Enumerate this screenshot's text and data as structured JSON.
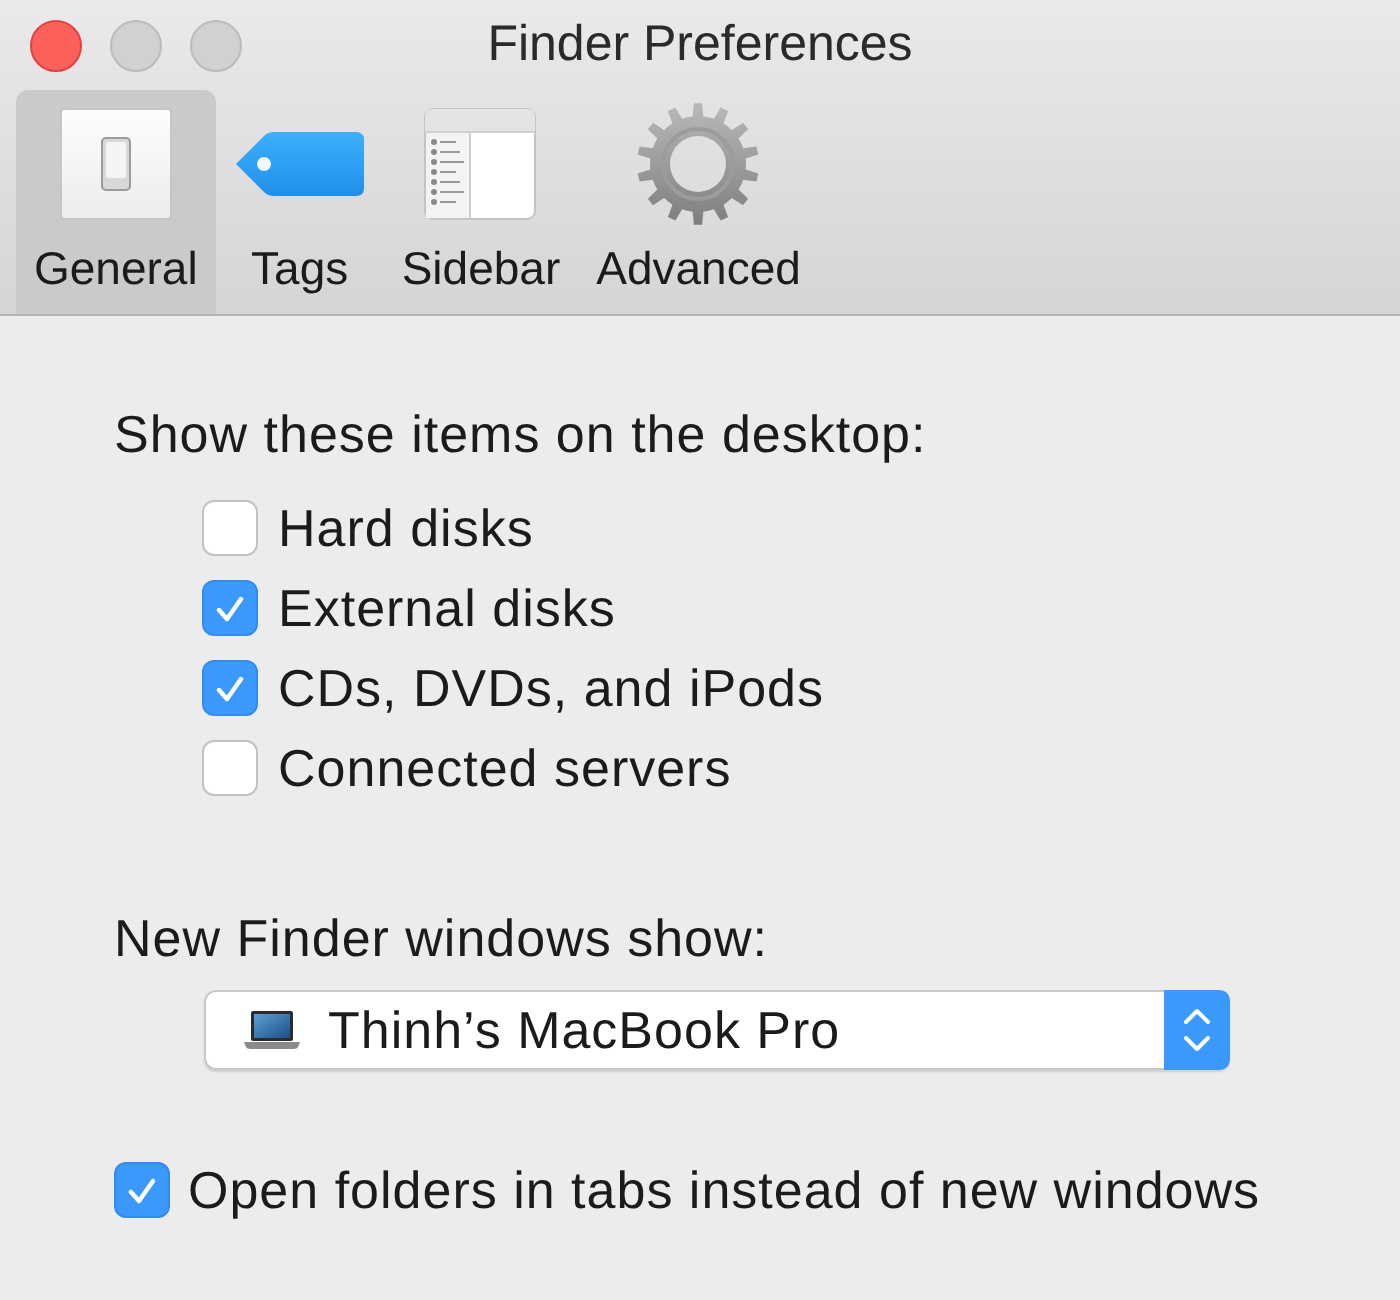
{
  "window": {
    "title": "Finder Preferences",
    "buttons": [
      {
        "disabled": false
      },
      {
        "disabled": true
      },
      {
        "disabled": true
      }
    ]
  },
  "tabs": [
    {
      "label": "General",
      "kind": "general",
      "selected": true
    },
    {
      "label": "Tags",
      "kind": "tags",
      "selected": false
    },
    {
      "label": "Sidebar",
      "kind": "sidebar",
      "selected": false
    },
    {
      "label": "Advanced",
      "kind": "advanced",
      "selected": false
    }
  ],
  "desktop_items": {
    "heading": "Show these items on the desktop:",
    "options": [
      {
        "label": "Hard disks",
        "checked": false
      },
      {
        "label": "External disks",
        "checked": true
      },
      {
        "label": "CDs, DVDs, and iPods",
        "checked": true
      },
      {
        "label": "Connected servers",
        "checked": false
      }
    ]
  },
  "new_windows": {
    "label": "New Finder windows show:",
    "value": "Thinh’s MacBook Pro"
  },
  "open_in_tabs": {
    "label": "Open folders in tabs instead of new windows",
    "checked": true
  }
}
